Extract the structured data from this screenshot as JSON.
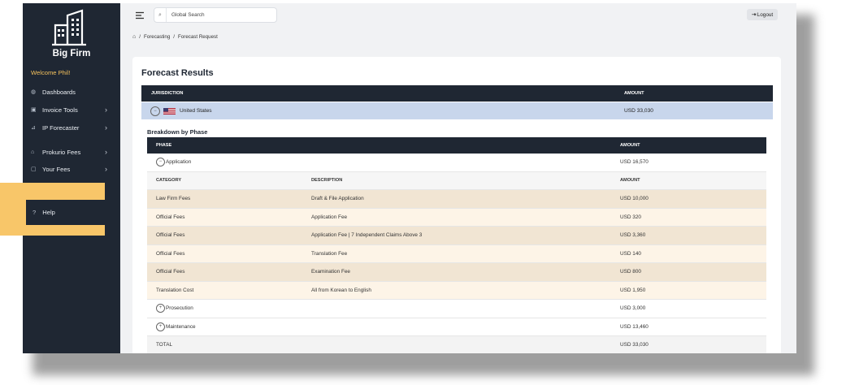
{
  "app": {
    "brand": "Big Firm",
    "welcome": "Welcome Phil!"
  },
  "sidebar": {
    "items": [
      {
        "label": "Dashboards",
        "icon": "dashboard-icon",
        "chevron": ""
      },
      {
        "label": "Invoice Tools",
        "icon": "invoice-icon",
        "chevron": "›"
      },
      {
        "label": "IP Forecaster",
        "icon": "chart-icon",
        "chevron": "›"
      },
      {
        "label": "Prokurio Fees",
        "icon": "bank-icon",
        "chevron": "›"
      },
      {
        "label": "Your Fees",
        "icon": "fees-icon",
        "chevron": "›"
      }
    ],
    "help": {
      "label": "Help",
      "icon": "?"
    }
  },
  "topbar": {
    "search_placeholder": "Global Search",
    "logout": "Logout"
  },
  "breadcrumb": {
    "sep": "/",
    "items": [
      "Forecasting",
      "Forecast Request"
    ]
  },
  "main": {
    "title": "Forecast Results",
    "jurisdiction_table": {
      "headers": [
        "JURISDICTION",
        "AMOUNT"
      ],
      "row": {
        "name": "United States",
        "amount": "USD 33,030",
        "toggle": "−"
      }
    },
    "breakdown_title": "Breakdown by Phase",
    "phase_table": {
      "headers": [
        "PHASE",
        "AMOUNT"
      ],
      "application": {
        "label": "Application",
        "amount": "USD 16,570",
        "toggle": "−"
      },
      "sub_headers": [
        "CATEGORY",
        "DESCRIPTION",
        "AMOUNT"
      ],
      "lines": [
        {
          "category": "Law Firm Fees",
          "description": "Draft & File Application",
          "amount": "USD 10,000"
        },
        {
          "category": "Official Fees",
          "description": "Application Fee",
          "amount": "USD 320"
        },
        {
          "category": "Official Fees",
          "description": "Application Fee | 7 Independent Claims Above 3",
          "amount": "USD 3,360"
        },
        {
          "category": "Official Fees",
          "description": "Translation Fee",
          "amount": "USD 140"
        },
        {
          "category": "Official Fees",
          "description": "Examination Fee",
          "amount": "USD 800"
        },
        {
          "category": "Translation Cost",
          "description": "All from Korean to English",
          "amount": "USD 1,950"
        }
      ],
      "prosecution": {
        "label": "Prosecution",
        "amount": "USD 3,000",
        "toggle": "+"
      },
      "maintenance": {
        "label": "Maintenance",
        "amount": "USD 13,460",
        "toggle": "+"
      },
      "total": {
        "label": "TOTAL",
        "amount": "USD 33,030"
      }
    }
  },
  "colors": {
    "sidebar": "#1f2733",
    "highlight": "#f8c669",
    "row_selected": "#c8d6ec",
    "row_tan_dark": "#f1e5d3",
    "row_tan_light": "#fdf4e7"
  }
}
